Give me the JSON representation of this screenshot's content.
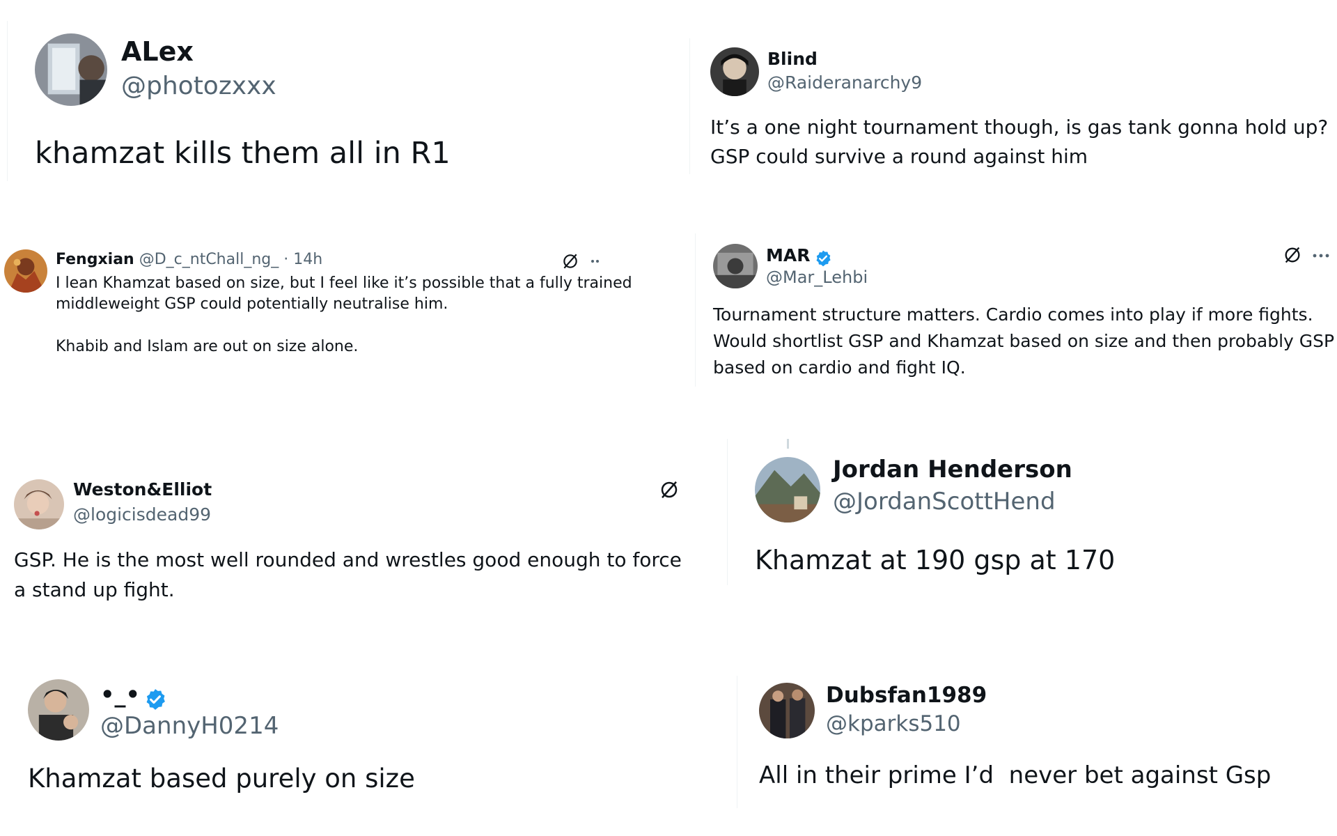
{
  "colors": {
    "text": "#0f1419",
    "muted": "#536471",
    "verified": "#1d9bf0",
    "divider": "#eff3f4"
  },
  "posts": [
    {
      "name": "ALex",
      "handle": "@photozxxx",
      "text": "khamzat kills them all in R1"
    },
    {
      "name": "Blind",
      "handle": "@Raideranarchy9",
      "text": "It’s a one night tournament though, is gas tank gonna hold up? GSP could survive a round against him"
    },
    {
      "name": "Fengxian",
      "handle": "@D_c_ntChall_ng_",
      "time": "· 14h",
      "text_lines": [
        "I lean Khamzat based on size, but I feel like it’s possible that a fully trained",
        "middleweight GSP could potentially neutralise him.",
        "Khabib and Islam are out on size alone."
      ]
    },
    {
      "name": "MAR",
      "handle": "@Mar_Lehbi",
      "verified": true,
      "text_lines": [
        "Tournament structure matters. Cardio comes into play if more fights.",
        "Would shortlist GSP and Khamzat based on size and then probably GSP",
        "based on cardio and fight IQ."
      ]
    },
    {
      "name": "Weston&Elliot",
      "handle": "@logicisdead99",
      "text": "GSP. He is the most well rounded and wrestles good enough to force a stand up fight."
    },
    {
      "name": "Jordan Henderson",
      "handle": "@JordanScottHend",
      "text": "Khamzat at 190 gsp at 170"
    },
    {
      "name": "•_•",
      "handle": "@DannyH0214",
      "verified": true,
      "text": "Khamzat based purely on size"
    },
    {
      "name": "Dubsfan1989",
      "handle": "@kparks510",
      "text": "All in their prime I’d  never bet against Gsp"
    }
  ],
  "icons": {
    "grok": "grok-icon",
    "more": "more-icon",
    "verified": "verified-badge-icon"
  }
}
